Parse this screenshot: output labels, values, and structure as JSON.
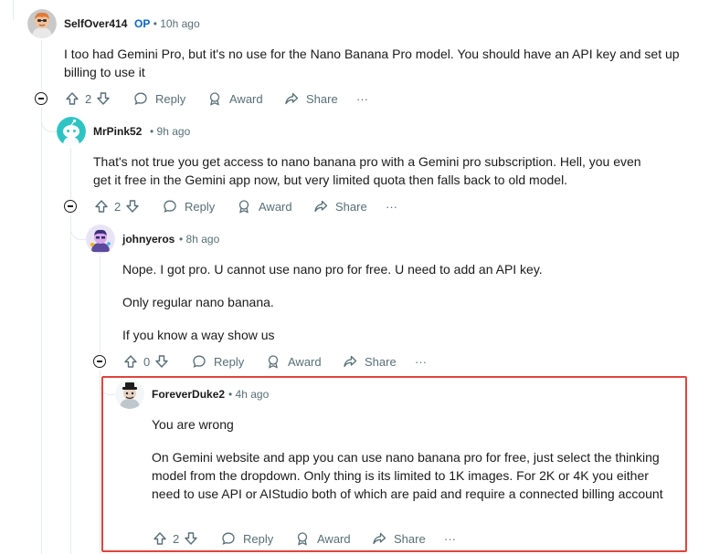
{
  "comments": [
    {
      "username": "SelfOver414",
      "op_badge": "OP",
      "time": "10h ago",
      "paragraphs": [
        "I too had Gemini Pro, but it's no use for the Nano Banana Pro model. You should have an API key and set up billing to use it"
      ],
      "votes": "2",
      "reply": "Reply",
      "award": "Award",
      "share": "Share",
      "more": "···"
    },
    {
      "username": "MrPink52",
      "time": "9h ago",
      "paragraphs": [
        "That's not true you get access to nano banana pro with a Gemini pro subscription. Hell, you even get it free in the Gemini app now, but very limited quota then falls back to old model."
      ],
      "votes": "2",
      "reply": "Reply",
      "award": "Award",
      "share": "Share",
      "more": "···"
    },
    {
      "username": "johnyeros",
      "time": "8h ago",
      "paragraphs": [
        "Nope. I got pro. U cannot use nano pro for free. U need to add an API key.",
        "Only regular nano banana.",
        "If you know a way show us"
      ],
      "votes": "0",
      "reply": "Reply",
      "award": "Award",
      "share": "Share",
      "more": "···"
    },
    {
      "username": "ForeverDuke2",
      "time": "4h ago",
      "paragraphs": [
        "You are wrong",
        "On Gemini website and app you can use nano banana pro for free, just select the thinking model from the dropdown. Only thing is its limited to 1K images. For 2K or 4K you either need to use API or AIStudio both of which are paid and require a connected billing account"
      ],
      "votes": "2",
      "reply": "Reply",
      "award": "Award",
      "share": "Share",
      "more": "···"
    }
  ],
  "separator": "•",
  "colors": {
    "text": "#1a1a1b",
    "meta": "#576f76",
    "op": "#0a66c2",
    "highlight": "#e0443d",
    "thread": "#e5ebee"
  }
}
